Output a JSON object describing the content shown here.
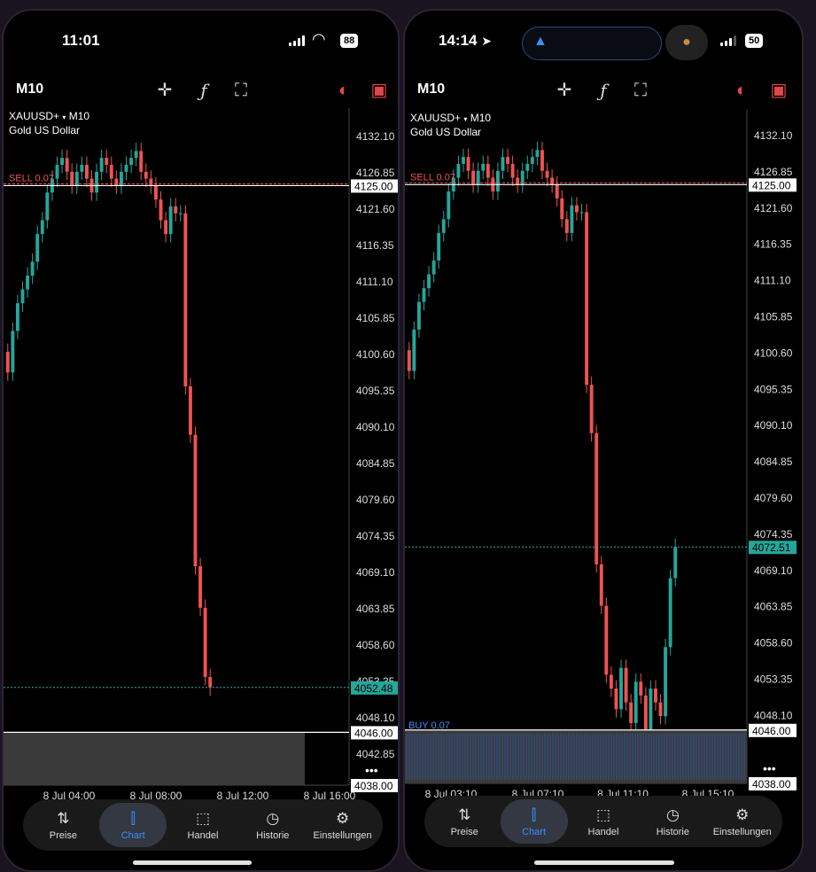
{
  "left": {
    "status": {
      "time": "11:01",
      "battery": "88"
    },
    "timeframe": "M10",
    "symbol": "XAUUSD+",
    "symbol_tf": "M10",
    "symbol_desc": "Gold US Dollar",
    "price_labels": [
      "4132.10",
      "4126.85",
      "4121.60",
      "4116.35",
      "4111.10",
      "4105.85",
      "4100.60",
      "4095.35",
      "4090.10",
      "4084.85",
      "4079.60",
      "4074.35",
      "4069.10",
      "4063.85",
      "4058.60",
      "4053.35",
      "4048.10",
      "4042.85"
    ],
    "order_line": {
      "label": "SELL 0.07",
      "price": "4125.00"
    },
    "current_price": "4052.48",
    "lower_line": "4046.00",
    "bottom_price": "4038.00",
    "time_labels": [
      "8 Jul 04:00",
      "8 Jul 08:00",
      "8 Jul 12:00",
      "8 Jul 16:00"
    ]
  },
  "right": {
    "status": {
      "time": "14:14",
      "battery": "50"
    },
    "timeframe": "M10",
    "symbol": "XAUUSD+",
    "symbol_tf": "M10",
    "symbol_desc": "Gold US Dollar",
    "price_labels": [
      "4132.10",
      "4126.85",
      "4121.60",
      "4116.35",
      "4111.10",
      "4105.85",
      "4100.60",
      "4095.35",
      "4090.10",
      "4084.85",
      "4079.60",
      "4074.35",
      "4069.10",
      "4063.85",
      "4058.60",
      "4053.35",
      "4048.10"
    ],
    "order_line": {
      "label": "SELL 0.07",
      "price": "4125.00"
    },
    "current_price": "4072.51",
    "lower_line": "4046.00",
    "bottom_price": "4038.00",
    "buy_label": "BUY 0.07",
    "time_labels": [
      "8 Jul 03:10",
      "8 Jul 07:10",
      "8 Jul 11:10",
      "8 Jul 15:10"
    ]
  },
  "nav": [
    {
      "label": "Preise",
      "icon": "updown-arrows-icon"
    },
    {
      "label": "Chart",
      "icon": "candlestick-icon"
    },
    {
      "label": "Handel",
      "icon": "trend-chart-icon"
    },
    {
      "label": "Historie",
      "icon": "history-clock-icon"
    },
    {
      "label": "Einstellungen",
      "icon": "gear-icon"
    }
  ],
  "colors": {
    "bull": "#26a69a",
    "bear": "#ef5350",
    "order": "#ef5350",
    "accent": "#3a8fff"
  }
}
